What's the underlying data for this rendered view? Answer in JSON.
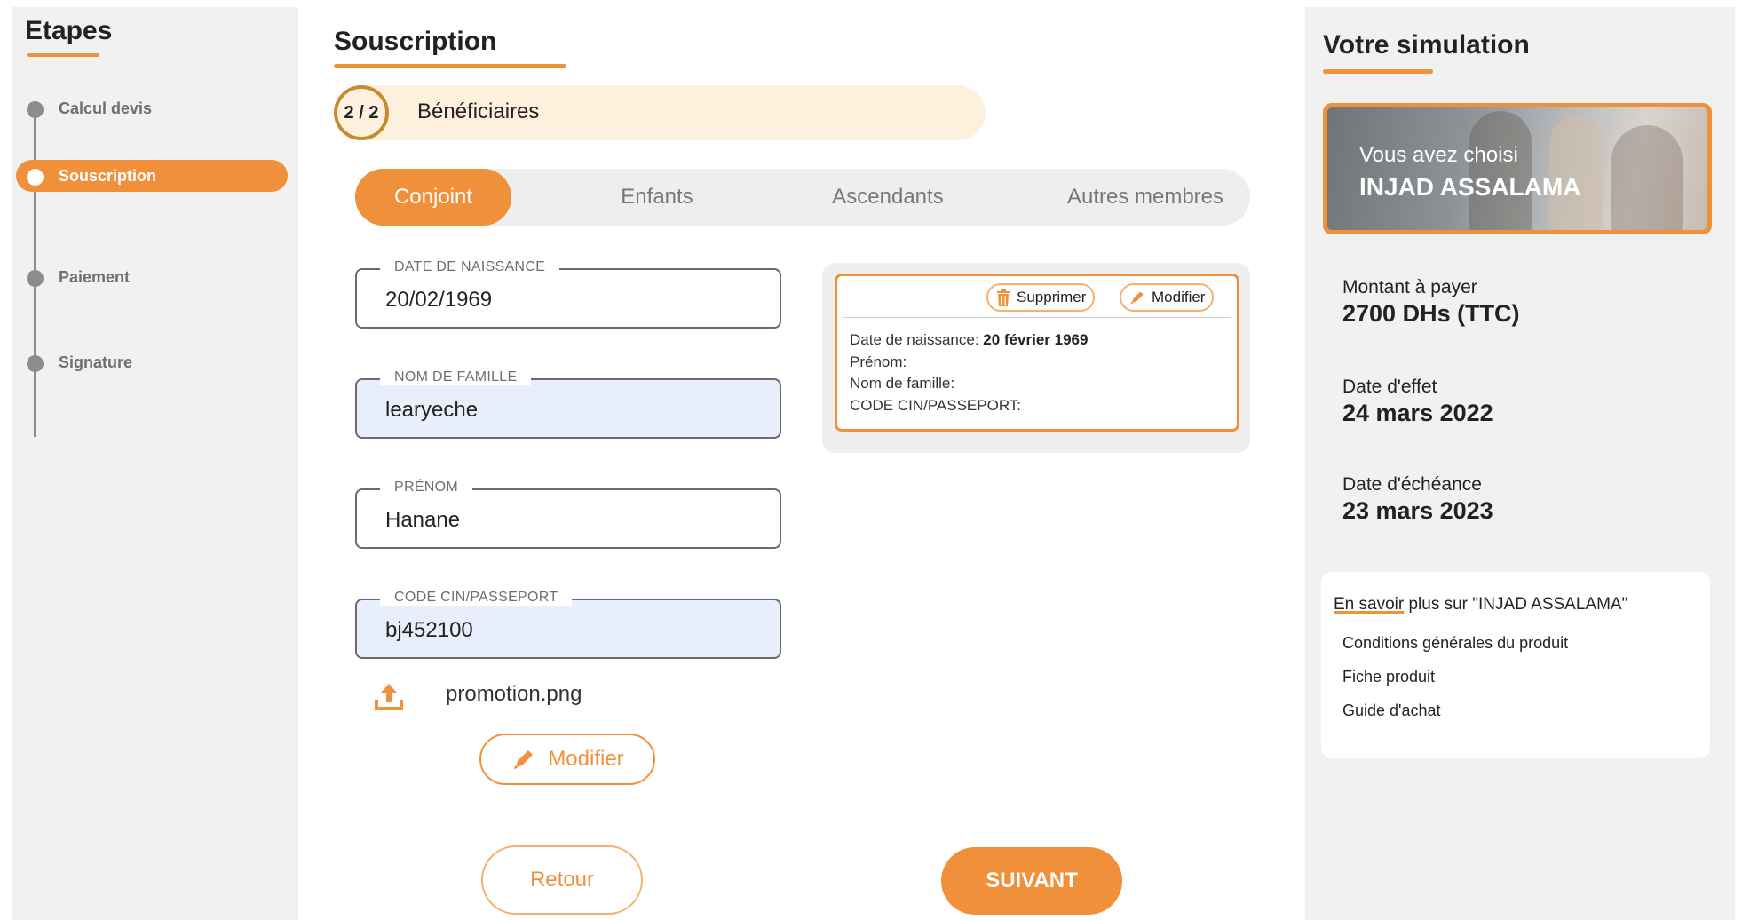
{
  "sidebar": {
    "title": "Etapes",
    "steps": [
      {
        "label": "Calcul devis"
      },
      {
        "label": "Souscription"
      },
      {
        "label": "Paiement"
      },
      {
        "label": "Signature"
      }
    ]
  },
  "main": {
    "title": "Souscription",
    "progress": {
      "badge": "2 / 2",
      "label": "Bénéficiaires"
    },
    "tabs": [
      {
        "label": "Conjoint"
      },
      {
        "label": "Enfants"
      },
      {
        "label": "Ascendants"
      },
      {
        "label": "Autres membres"
      }
    ],
    "fields": {
      "birthdate": {
        "label": "DATE DE NAISSANCE",
        "value": "20/02/1969"
      },
      "lastname": {
        "label": "NOM DE FAMILLE",
        "value": "learyeche"
      },
      "firstname": {
        "label": "PRÉNOM",
        "value": "Hanane"
      },
      "cin": {
        "label": "CODE CIN/PASSEPORT",
        "value": "bj452100"
      }
    },
    "upload": {
      "filename": "promotion.png"
    },
    "modify_label": "Modifier",
    "back_label": "Retour",
    "next_label": "SUIVANT"
  },
  "summary": {
    "delete_label": "Supprimer",
    "edit_label": "Modifier",
    "birthdate_label": "Date de naissance:",
    "birthdate_value": "20 février 1969",
    "firstname_label": "Prénom:",
    "lastname_label": "Nom de famille:",
    "cin_label": "CODE CIN/PASSEPORT:"
  },
  "simulation": {
    "title": "Votre simulation",
    "promo_line1": "Vous avez choisi",
    "promo_line2": "INJAD ASSALAMA",
    "amount_label": "Montant à payer",
    "amount_value": "2700 DHs (TTC)",
    "effect_label": "Date d'effet",
    "effect_value": "24 mars 2022",
    "due_label": "Date d'échéance",
    "due_value": "23 mars 2023",
    "more_title_underlined": "En savoir",
    "more_title_rest": " plus sur \"INJAD ASSALAMA\"",
    "links": [
      "Conditions générales du produit",
      "Fiche produit",
      "Guide d'achat"
    ]
  },
  "colors": {
    "accent": "#f1903b",
    "panel": "#f1f1f2",
    "field_filled": "#e8eefb"
  },
  "icons": {
    "upload": "upload-icon",
    "trash": "trash-icon",
    "pencil": "pencil-icon"
  }
}
